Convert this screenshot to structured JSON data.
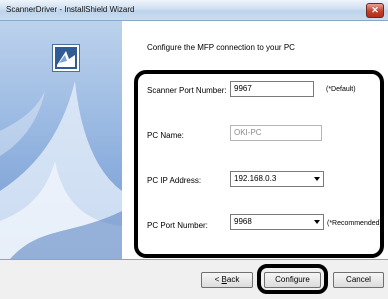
{
  "window": {
    "title": "ScannerDriver - InstallShield Wizard",
    "close_glyph": "✕"
  },
  "main": {
    "heading": "Configure the MFP connection to your PC",
    "scanner_port": {
      "label": "Scanner Port Number:",
      "value": "9967",
      "note": "(*Default)"
    },
    "pc_name": {
      "label": "PC Name:",
      "value": "OKI-PC"
    },
    "pc_ip": {
      "label": "PC IP Address:",
      "value": "192.168.0.3"
    },
    "pc_port": {
      "label": "PC Port Number:",
      "value": "9968",
      "note": "(*Recommended)"
    }
  },
  "buttons": {
    "back_prefix": "< ",
    "back_underlined": "B",
    "back_rest": "ack",
    "configure": "Configure",
    "cancel": "Cancel"
  },
  "icons": {
    "close": "close-icon",
    "logo": "installer-logo-icon",
    "dropdown": "chevron-down-icon"
  },
  "colors": {
    "title_bar": "#cfdff0",
    "left_panel": "#9dbbe3",
    "close_button": "#c3402c",
    "highlight": "#000000"
  }
}
